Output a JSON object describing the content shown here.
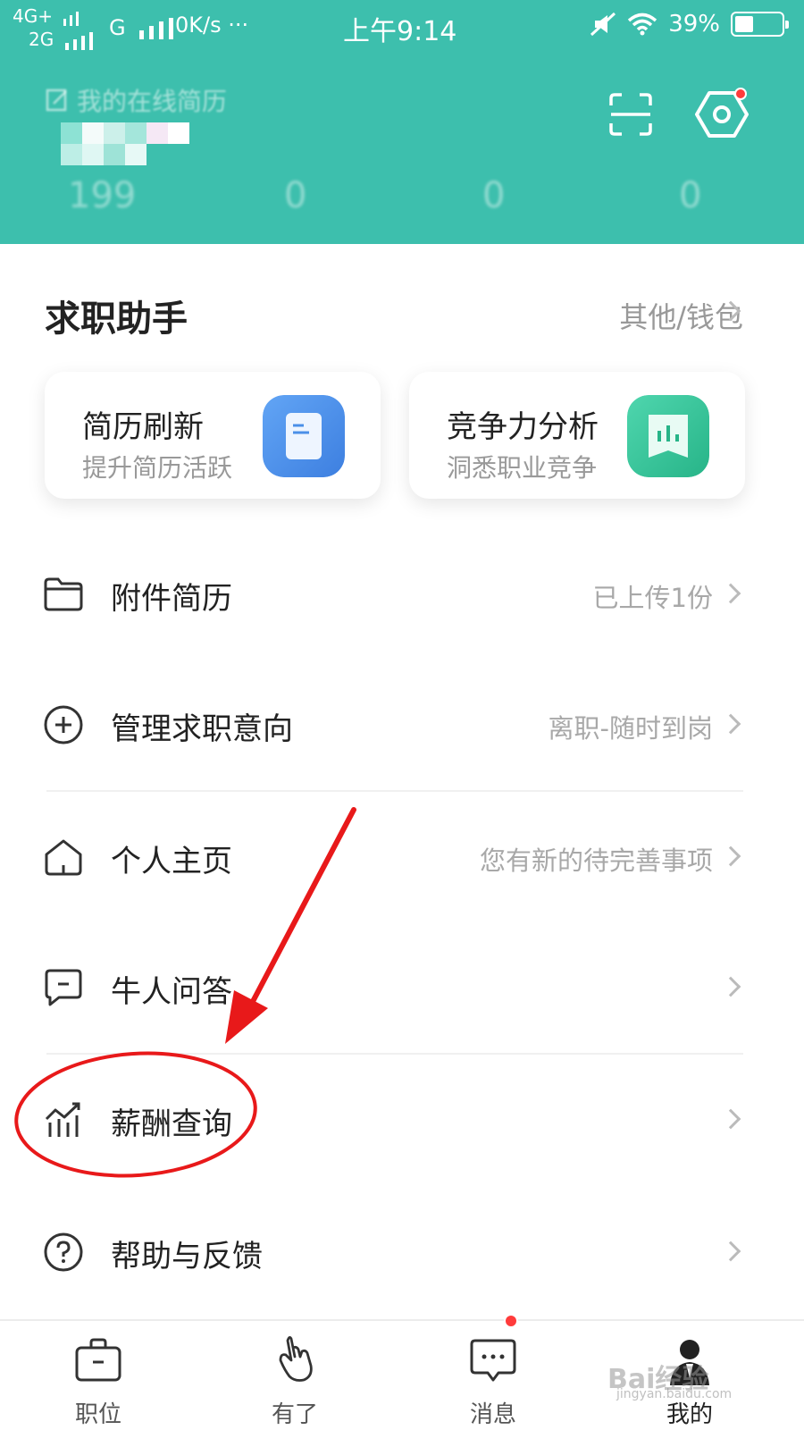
{
  "status_bar": {
    "network_1": "4G+",
    "network_2": "2G",
    "network_3": "G",
    "speed": "0K/s",
    "dots": "···",
    "time": "上午9:14",
    "battery": "39%",
    "battery_level_percent": 39
  },
  "header": {
    "resume_link": "我的在线简历",
    "stats": [
      "199",
      "0",
      "0",
      "0"
    ],
    "bg_color": "#3dbfad",
    "settings_badge_color": "#ff3b3b"
  },
  "helper": {
    "title": "求职助手",
    "more": "其他/钱包",
    "cards": [
      {
        "title": "简历刷新",
        "subtitle": "提升简历活跃",
        "icon": "resume-doc-icon",
        "color": "#4a8fe8"
      },
      {
        "title": "竞争力分析",
        "subtitle": "洞悉职业竞争",
        "icon": "bar-chart-icon",
        "color": "#35c49a"
      }
    ]
  },
  "menu": [
    {
      "label": "附件简历",
      "value": "已上传1份",
      "icon": "folder-icon"
    },
    {
      "label": "管理求职意向",
      "value": "离职-随时到岗",
      "icon": "plus-circle-icon"
    },
    {
      "label": "个人主页",
      "value": "您有新的待完善事项",
      "icon": "home-icon"
    },
    {
      "label": "牛人问答",
      "value": "",
      "icon": "chat-icon"
    },
    {
      "label": "薪酬查询",
      "value": "",
      "icon": "salary-chart-icon"
    },
    {
      "label": "帮助与反馈",
      "value": "",
      "icon": "help-icon"
    }
  ],
  "nav": {
    "tabs": [
      {
        "label": "职位",
        "icon": "briefcase-icon"
      },
      {
        "label": "有了",
        "icon": "hand-icon"
      },
      {
        "label": "消息",
        "icon": "message-icon"
      },
      {
        "label": "我的",
        "icon": "person-icon"
      }
    ],
    "watermark": "Bai经验",
    "watermark_sub": "jingyan.baidu.com"
  },
  "annotation": {
    "color": "#e8191a"
  }
}
